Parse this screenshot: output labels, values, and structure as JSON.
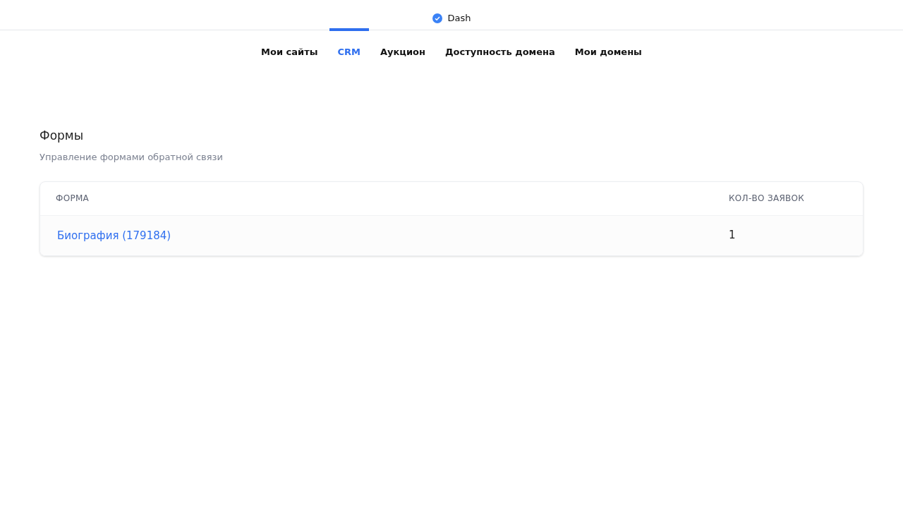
{
  "header": {
    "title": "Dash",
    "verified": true
  },
  "tabs": [
    {
      "label": "Мои сайты",
      "selected": false
    },
    {
      "label": "CRM",
      "selected": true
    },
    {
      "label": "Аукцион",
      "selected": false
    },
    {
      "label": "Доступность домена",
      "selected": false
    },
    {
      "label": "Мои домены",
      "selected": false
    }
  ],
  "section": {
    "title": "Формы",
    "subtitle": "Управление формами обратной связи"
  },
  "table": {
    "columns": [
      "ФОРМА",
      "КОЛ-ВО ЗАЯВОК"
    ],
    "rows": [
      {
        "form": "Биография (179184)",
        "count": "1"
      }
    ]
  }
}
